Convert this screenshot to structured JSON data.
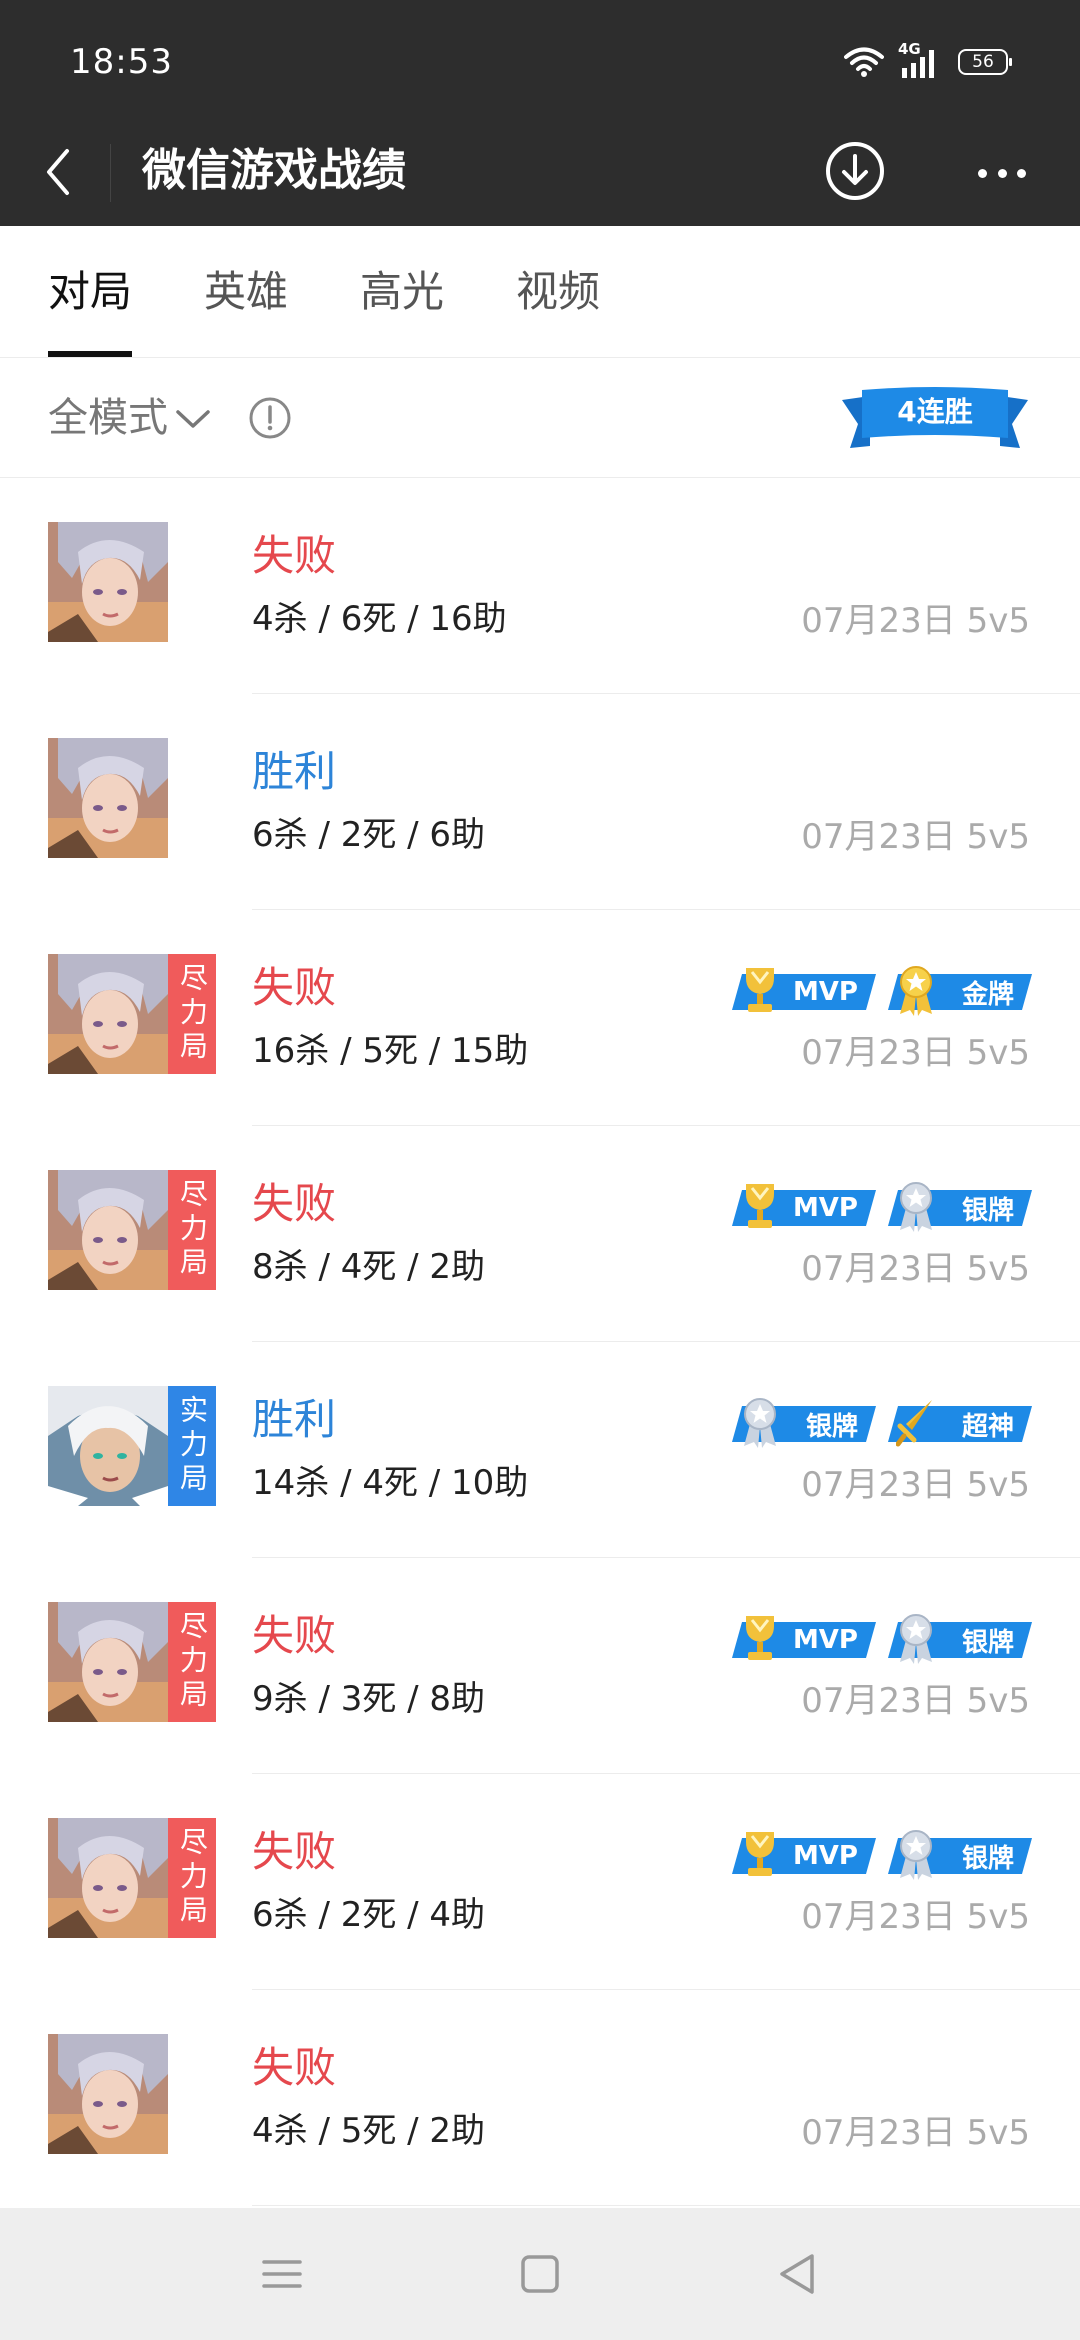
{
  "status": {
    "time": "18:53",
    "network": "4G",
    "battery": "56"
  },
  "header": {
    "title": "微信游戏战绩",
    "back_icon": "chevron-left-icon",
    "download_icon": "download-icon",
    "more_icon": "more-icon"
  },
  "tabs": [
    {
      "label": "对局",
      "active": true
    },
    {
      "label": "英雄",
      "active": false
    },
    {
      "label": "高光",
      "active": false
    },
    {
      "label": "视频",
      "active": false
    }
  ],
  "filter": {
    "mode_label": "全模式",
    "streak": "4连胜"
  },
  "colors": {
    "lose": "#e5484d",
    "win": "#2d84d8",
    "badge_blue": "#1e8ae6",
    "tag_red": "#f05b5b",
    "tag_blue": "#2f86e6"
  },
  "matches": [
    {
      "result": "失败",
      "outcome": "lose",
      "kda": "4杀 / 6死 / 16助",
      "meta": "07月23日 5v5",
      "hero": "silver-hair",
      "tag": null,
      "badges": []
    },
    {
      "result": "胜利",
      "outcome": "win",
      "kda": "6杀 / 2死 / 6助",
      "meta": "07月23日 5v5",
      "hero": "silver-hair",
      "tag": null,
      "badges": []
    },
    {
      "result": "失败",
      "outcome": "lose",
      "kda": "16杀 / 5死 / 15助",
      "meta": "07月23日 5v5",
      "hero": "silver-hair",
      "tag": "尽力局",
      "tag_color": "red",
      "badges": [
        {
          "label": "MVP",
          "icon": "trophy"
        },
        {
          "label": "金牌",
          "icon": "gold-medal"
        }
      ]
    },
    {
      "result": "失败",
      "outcome": "lose",
      "kda": "8杀 / 4死 / 2助",
      "meta": "07月23日 5v5",
      "hero": "silver-hair",
      "tag": "尽力局",
      "tag_color": "red",
      "badges": [
        {
          "label": "MVP",
          "icon": "trophy"
        },
        {
          "label": "银牌",
          "icon": "silver-medal"
        }
      ]
    },
    {
      "result": "胜利",
      "outcome": "win",
      "kda": "14杀 / 4死 / 10助",
      "meta": "07月23日 5v5",
      "hero": "white-hair",
      "tag": "实力局",
      "tag_color": "blue",
      "badges": [
        {
          "label": "银牌",
          "icon": "silver-medal"
        },
        {
          "label": "超神",
          "icon": "sword"
        }
      ]
    },
    {
      "result": "失败",
      "outcome": "lose",
      "kda": "9杀 / 3死 / 8助",
      "meta": "07月23日 5v5",
      "hero": "silver-hair",
      "tag": "尽力局",
      "tag_color": "red",
      "badges": [
        {
          "label": "MVP",
          "icon": "trophy"
        },
        {
          "label": "银牌",
          "icon": "silver-medal"
        }
      ]
    },
    {
      "result": "失败",
      "outcome": "lose",
      "kda": "6杀 / 2死 / 4助",
      "meta": "07月23日 5v5",
      "hero": "silver-hair",
      "tag": "尽力局",
      "tag_color": "red",
      "badges": [
        {
          "label": "MVP",
          "icon": "trophy"
        },
        {
          "label": "银牌",
          "icon": "silver-medal"
        }
      ]
    },
    {
      "result": "失败",
      "outcome": "lose",
      "kda": "4杀 / 5死 / 2助",
      "meta": "07月23日 5v5",
      "hero": "silver-hair",
      "tag": null,
      "badges": []
    }
  ],
  "system_nav": {
    "menu_icon": "menu-icon",
    "home_icon": "home-icon",
    "back_icon": "back-triangle-icon"
  }
}
